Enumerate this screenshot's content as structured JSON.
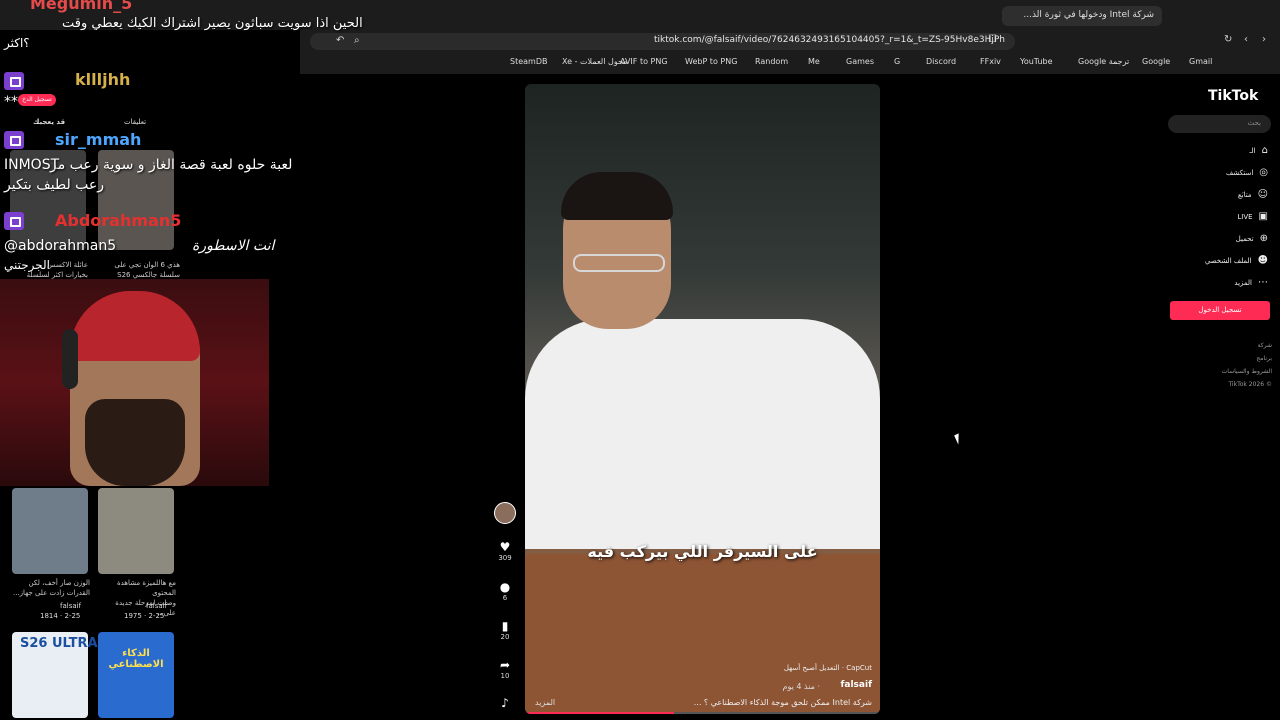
{
  "browser": {
    "tab_title": "شركة Intel ودخولها في ثورة الذ...",
    "tab_close": "✕",
    "new_tab": "+",
    "url": "tiktok.com/@falsaif/video/7624632493165104405?_r=1&_t=ZS-95Hv8e3HjPh",
    "bookmarks": [
      "SteamDB",
      "Xe - محول العملات",
      "AVIF to PNG",
      "WebP to PNG",
      "Random",
      "Me",
      "Games",
      "G",
      "Discord",
      "FFxiv",
      "YouTube",
      "Google ترجمة",
      "Google",
      "Gmail"
    ]
  },
  "stream_overlay": {
    "top_user": "Megumin_5",
    "top_message_1": "الحين اذا سويت سباثون يصير اشتراك الكيك يعطي وقت",
    "top_message_2": "؟اكثر",
    "user_2": "kllljhh",
    "user_2_msg": "***",
    "user_3": "sir_mmah",
    "user_3_msg_1": "لعبة حلوه لعبة قصة الغاز و سوية رعب مر",
    "user_3_msg_2": "INMOST",
    "user_3_msg_3": "رعب لطيف بتكير",
    "user_4": "Abdorahman5",
    "user_4_msg_1": "@abdorahman5",
    "user_4_msg_2": "انت الاسطورة",
    "user_4_msg_3": "الجرجتني",
    "tab_liked": "قد يعجبك",
    "tab_comments": "تعليقات",
    "login_small": "تسجيل الدخ"
  },
  "left_tiles": [
    {
      "cap1": "هذي 6 الوان تجي على",
      "cap2": "سلسلة جالكسي S26"
    },
    {
      "cap1": "عائلة الاكسس",
      "cap2": "بخيارات اكثر لسلسلة"
    },
    {
      "cap1": "مع هاللميزة مشاهدة المحتوى",
      "cap2": "وصلت لمرحلة جديدة على...",
      "author": "falsaif",
      "stats": "1975 · 2-25"
    },
    {
      "cap1": "الوزن صار أخف، لكن",
      "cap2": "القدرات زادت على جهاز...",
      "author": "falsaif",
      "stats": "1814 · 2-25"
    },
    {
      "label": "الذكاء الاصطناعي"
    },
    {
      "label": "S26 ULTRA"
    }
  ],
  "video": {
    "caption": "على السيرفر اللي بيركب فيه",
    "author": "falsaif",
    "time": "منذ 4 يوم ·",
    "description": "شركة Intel ممكن تلحق موجة الذكاء الاصطناعي ؟ ...",
    "more": "المزيد",
    "capcut": "CapCut · التعديل أصبح أسهل",
    "progress": 0.42
  },
  "actions": {
    "likes": "309",
    "comments": "6",
    "saves": "20",
    "shares": "10"
  },
  "tiktok_sidebar": {
    "logo": "TikTok",
    "search_placeholder": "بحث",
    "menu": [
      "الـ",
      "استكشف",
      "متابَع",
      "LIVE",
      "تحميل",
      "الملف الشخصي",
      "المزيد"
    ],
    "login": "تسجيل الدخول",
    "footer": [
      "شركة",
      "برنامج",
      "الشروط والسياسات",
      "© 2026 TikTok"
    ]
  }
}
